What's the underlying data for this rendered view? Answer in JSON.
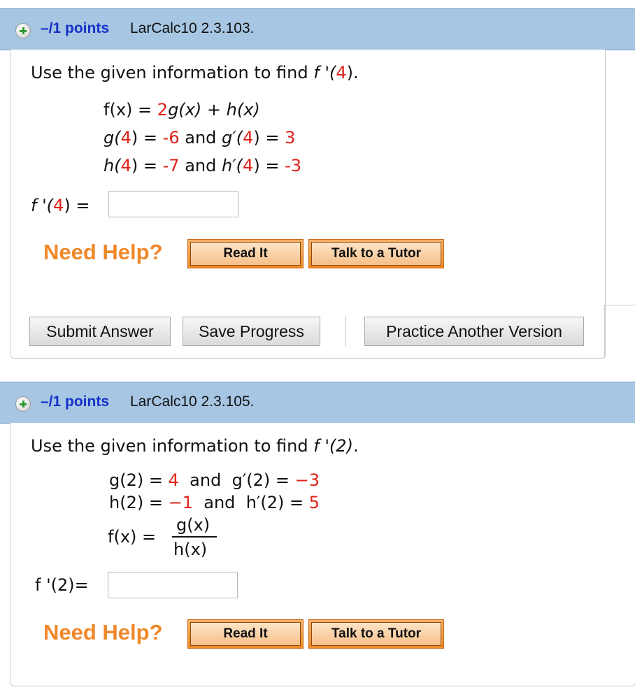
{
  "q1": {
    "points": "–/1 points",
    "id": "LarCalc10 2.3.103.",
    "prompt_text": "Use the given information to find",
    "prompt_target": "f '(4)",
    "prompt_end": ".",
    "eq1": {
      "lhs": "f(x)",
      "eq": "=",
      "coef": "2",
      "g": "g(x)",
      "plus": "+",
      "h": "h(x)"
    },
    "eq2": {
      "g_at": "g(",
      "g_arg": "4",
      "g_close": ")",
      "eq1": "=",
      "g_val": "-6",
      "and": "and",
      "gp_at": "g′(",
      "gp_arg": "4",
      "gp_close": ")",
      "eq2": "=",
      "gp_val": "3"
    },
    "eq3": {
      "h_at": "h(",
      "h_arg": "4",
      "h_close": ")",
      "eq1": "=",
      "h_val": "-7",
      "and": "and",
      "hp_at": "h′(",
      "hp_arg": "4",
      "hp_close": ")",
      "eq2": "=",
      "hp_val": "-3"
    },
    "answer_label_pre": "f '(",
    "answer_label_arg": "4",
    "answer_label_post": ") =",
    "answer_value": "",
    "need_help": "Need Help?",
    "read_it": "Read It",
    "talk_tutor": "Talk to a Tutor",
    "submit": "Submit Answer",
    "save": "Save Progress",
    "practice": "Practice Another Version"
  },
  "q2": {
    "points": "–/1 points",
    "id": "LarCalc10 2.3.105.",
    "prompt_text": "Use the given information to find",
    "prompt_target": "f '(2)",
    "prompt_end": ".",
    "eq1": {
      "g": "g(2)",
      "eq1": "=",
      "g_val": "4",
      "and": "and",
      "gp": "g′(2)",
      "eq2": "=",
      "gp_val": "−3"
    },
    "eq2": {
      "h": "h(2)",
      "eq1": "=",
      "h_val": "−1",
      "and": "and",
      "hp": "h′(2)",
      "eq2": "=",
      "hp_val": "5"
    },
    "eq3": {
      "lhs": "f(x)",
      "eq": "=",
      "num": "g(x)",
      "den": "h(x)"
    },
    "answer_label": "f '(2)=",
    "answer_value": "",
    "need_help": "Need Help?",
    "read_it": "Read It",
    "talk_tutor": "Talk to a Tutor"
  },
  "colors": {
    "header_bg": "#a6c6e3",
    "points_blue": "#1531c8",
    "highlight_red": "#e0231a",
    "help_orange": "#f0882a"
  }
}
